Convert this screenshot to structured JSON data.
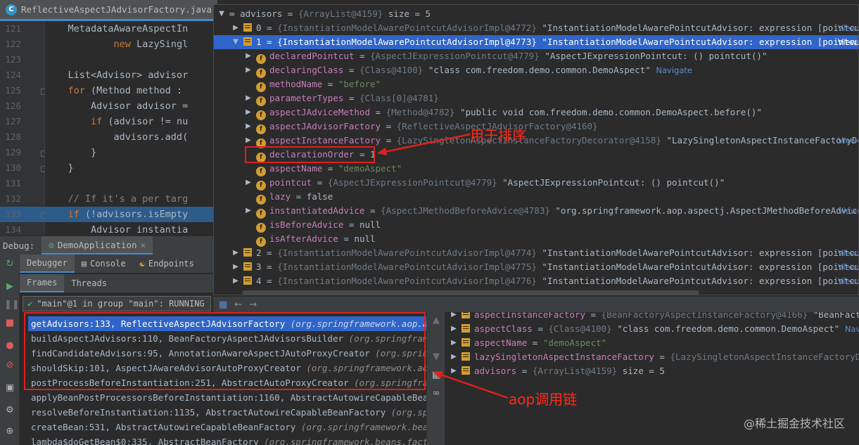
{
  "editor": {
    "tab_title": "ReflectiveAspectJAdvisorFactory.java",
    "line_numbers": [
      "121",
      "122",
      "123",
      "124",
      "125",
      "126",
      "127",
      "128",
      "129",
      "130",
      "131",
      "132",
      "133",
      "134"
    ],
    "lines": [
      "    MetadataAwareAspectIn",
      "            new LazySingl",
      "",
      "    List<Advisor> advisor",
      "    for (Method method :",
      "        Advisor advisor =",
      "        if (advisor != nu",
      "            advisors.add(",
      "        }",
      "    }",
      "",
      "    // If it's a per targ",
      "    if (!advisors.isEmpty",
      "        Advisor instantia"
    ]
  },
  "debug": {
    "label": "Debug:",
    "session_tab": "DemoApplication",
    "tabs": [
      "Debugger",
      "Console",
      "Endpoints"
    ],
    "frame_tabs": [
      "Frames",
      "Threads"
    ],
    "thread": "\"main\"@1 in group \"main\": RUNNING",
    "frames": [
      {
        "method": "getAdvisors:133, ReflectiveAspectJAdvisorFactory",
        "pkg": "(org.springframework.aop.aspect"
      },
      {
        "method": "buildAspectJAdvisors:110, BeanFactoryAspectJAdvisorsBuilder",
        "pkg": "(org.springframework"
      },
      {
        "method": "findCandidateAdvisors:95, AnnotationAwareAspectJAutoProxyCreator",
        "pkg": "(org.springfram"
      },
      {
        "method": "shouldSkip:101, AspectJAwareAdvisorAutoProxyCreator",
        "pkg": "(org.springframework.aop.asp"
      },
      {
        "method": "postProcessBeforeInstantiation:251, AbstractAutoProxyCreator",
        "pkg": "(org.springframework"
      },
      {
        "method": "applyBeanPostProcessorsBeforeInstantiation:1160, AbstractAutowireCapableBeanFact",
        "pkg": ""
      },
      {
        "method": "resolveBeforeInstantiation:1135, AbstractAutowireCapableBeanFactory",
        "pkg": "(org.springf"
      },
      {
        "method": "createBean:531, AbstractAutowireCapableBeanFactory",
        "pkg": "(org.springframework.beans.fac"
      },
      {
        "method": "lambda$doGetBean$0:335, AbstractBeanFactory",
        "pkg": "(org.springframework.beans.factory.su"
      }
    ]
  },
  "tree": {
    "root": {
      "name": "advisors",
      "type": "{ArrayList@4159}",
      "extra": "size = 5"
    },
    "items": [
      {
        "idx": "0",
        "type": "{InstantiationModelAwarePointcutAdvisorImpl@4772}",
        "val": "\"InstantiationModelAwarePointcutAdvisor: expression [pointcut(",
        "view": "View"
      },
      {
        "idx": "1",
        "type": "{InstantiationModelAwarePointcutAdvisorImpl@4773}",
        "val": "\"InstantiationModelAwarePointcutAdvisor: expression [pointcut(",
        "view": "View"
      }
    ],
    "fields": [
      {
        "name": "declaredPointcut",
        "type": "{AspectJExpressionPointcut@4779}",
        "val": "\"AspectJExpressionPointcut: () pointcut()\"",
        "view": ""
      },
      {
        "name": "declaringClass",
        "type": "{Class@4100}",
        "val": "\"class com.freedom.demo.common.DemoAspect\"",
        "nav": "Navigate",
        "view": ""
      },
      {
        "name": "methodName",
        "type": "",
        "val": "\"before\"",
        "view": ""
      },
      {
        "name": "parameterTypes",
        "type": "{Class[0]@4781}",
        "val": "",
        "view": ""
      },
      {
        "name": "aspectJAdviceMethod",
        "type": "{Method@4782}",
        "val": "\"public void com.freedom.demo.common.DemoAspect.before()\"",
        "view": ""
      },
      {
        "name": "aspectJAdvisorFactory",
        "type": "{ReflectiveAspectJAdvisorFactory@4160}",
        "val": "",
        "view": ""
      },
      {
        "name": "aspectInstanceFactory",
        "type": "{LazySingletonAspectInstanceFactoryDecorator@4158}",
        "val": "\"LazySingletonAspectInstanceFactoryDec",
        "view": "View"
      },
      {
        "name": "declarationOrder",
        "type": "",
        "val": "1",
        "view": ""
      },
      {
        "name": "aspectName",
        "type": "",
        "val": "\"demoAspect\"",
        "view": ""
      },
      {
        "name": "pointcut",
        "type": "{AspectJExpressionPointcut@4779}",
        "val": "\"AspectJExpressionPointcut: () pointcut()\"",
        "view": ""
      },
      {
        "name": "lazy",
        "type": "",
        "val": "false",
        "view": ""
      },
      {
        "name": "instantiatedAdvice",
        "type": "{AspectJMethodBeforeAdvice@4783}",
        "val": "\"org.springframework.aop.aspectj.AspectJMethodBeforeAdvice:",
        "view": "View"
      },
      {
        "name": "isBeforeAdvice",
        "type": "",
        "val": "null",
        "view": ""
      },
      {
        "name": "isAfterAdvice",
        "type": "",
        "val": "null",
        "view": ""
      }
    ],
    "rest": [
      {
        "idx": "2",
        "type": "{InstantiationModelAwarePointcutAdvisorImpl@4774}",
        "val": "\"InstantiationModelAwarePointcutAdvisor: expression [pointcut(",
        "view": "View"
      },
      {
        "idx": "3",
        "type": "{InstantiationModelAwarePointcutAdvisorImpl@4775}",
        "val": "\"InstantiationModelAwarePointcutAdvisor: expression [pointcut(",
        "view": "View"
      },
      {
        "idx": "4",
        "type": "{InstantiationModelAwarePointcutAdvisorImpl@4776}",
        "val": "\"InstantiationModelAwarePointcutAdvisor: expression [pointcut(",
        "view": "View"
      }
    ]
  },
  "lower_vars": [
    {
      "name": "aspectInstanceFactory",
      "type": "{BeanFactoryAspectInstanceFactory@4166}",
      "val": "\"BeanFactoryAs"
    },
    {
      "name": "aspectClass",
      "type": "{Class@4100}",
      "val": "\"class com.freedom.demo.common.DemoAspect\"",
      "nav": "Navigat"
    },
    {
      "name": "aspectName",
      "type": "",
      "val": "\"demoAspect\""
    },
    {
      "name": "lazySingletonAspectInstanceFactory",
      "type": "{LazySingletonAspectInstanceFactoryDecora",
      "val": ""
    },
    {
      "name": "advisors",
      "type": "{ArrayList@4159}",
      "val": "size = 5"
    }
  ],
  "annotations": {
    "sort_label": "用于排序",
    "chain_label": "aop调用链",
    "watermark": "@稀土掘金技术社区"
  },
  "colors": {
    "selection": "#2f65ca",
    "annotation": "#ff2a1a",
    "keyword": "#cc7832",
    "string": "#6a8759"
  }
}
